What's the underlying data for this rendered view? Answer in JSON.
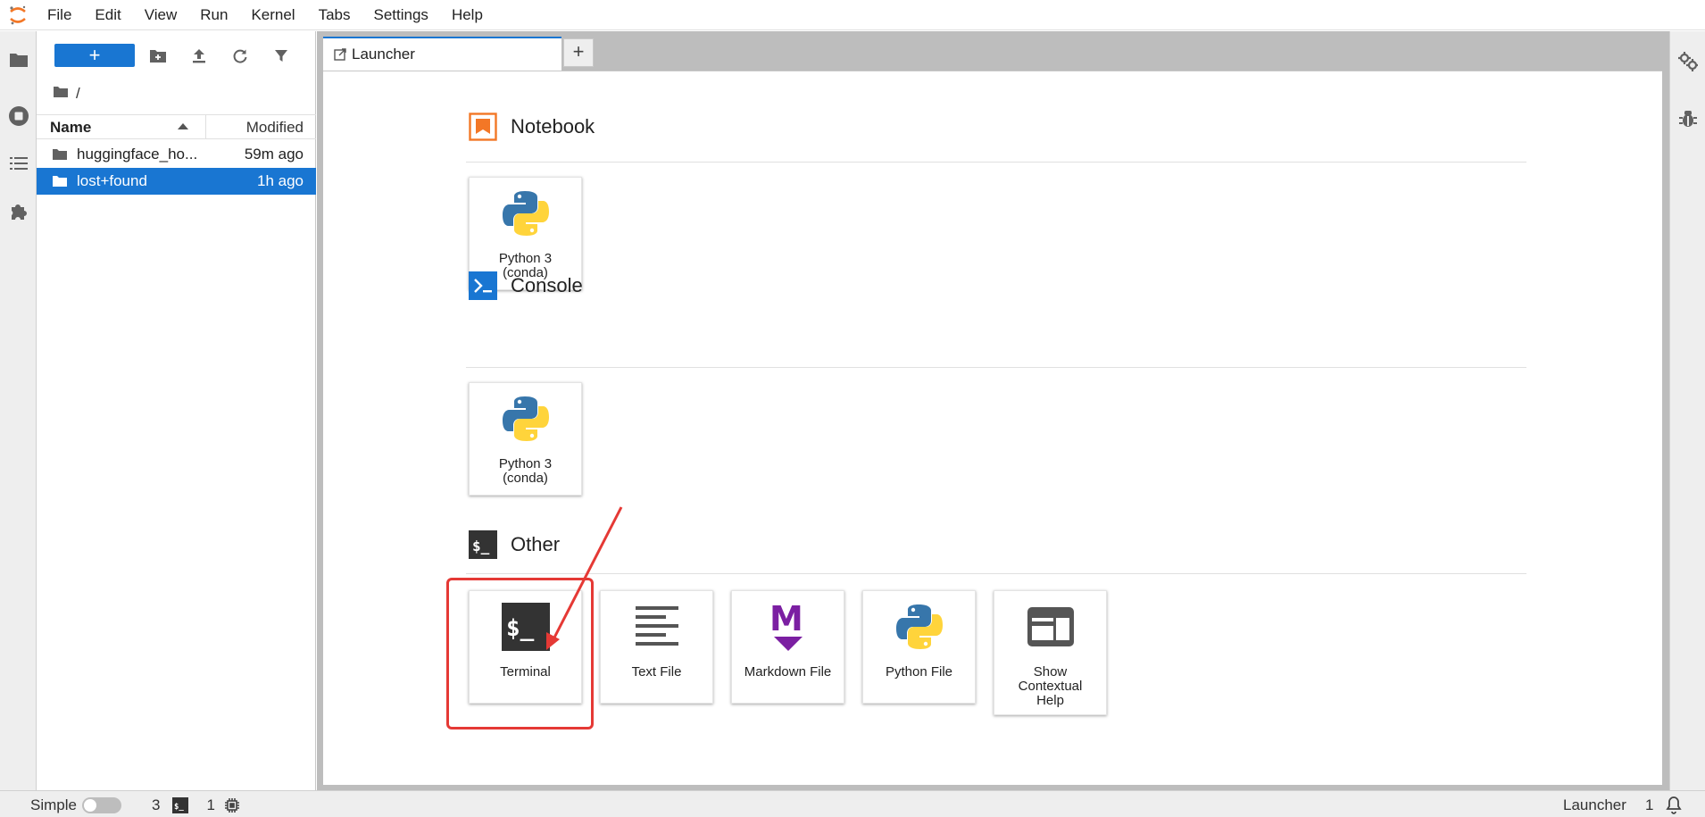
{
  "menubar": {
    "items": [
      "File",
      "Edit",
      "View",
      "Run",
      "Kernel",
      "Tabs",
      "Settings",
      "Help"
    ]
  },
  "filebrowser": {
    "new_label": "+",
    "breadcrumb": "/",
    "columns": {
      "name": "Name",
      "modified": "Modified"
    },
    "rows": [
      {
        "name": "huggingface_ho...",
        "modified": "59m ago"
      },
      {
        "name": "lost+found",
        "modified": "1h ago"
      }
    ]
  },
  "tabs": {
    "active_label": "Launcher",
    "add_label": "+"
  },
  "launcher": {
    "notebook": {
      "title": "Notebook",
      "cards": [
        {
          "line1": "Python 3",
          "line2": "(conda)"
        }
      ]
    },
    "console": {
      "title": "Console",
      "cards": [
        {
          "line1": "Python 3",
          "line2": "(conda)"
        }
      ]
    },
    "other": {
      "title": "Other",
      "cards": [
        {
          "label": "Terminal"
        },
        {
          "label": "Text File"
        },
        {
          "label": "Markdown File"
        },
        {
          "label": "Python File"
        },
        {
          "line1": "Show",
          "line2": "Contextual",
          "line3": "Help"
        }
      ]
    }
  },
  "statusbar": {
    "mode_label": "Simple",
    "kernels_count": "3",
    "terminals_count": "1",
    "right_label": "Launcher",
    "notifications_count": "1"
  },
  "colors": {
    "accent": "#1976d2",
    "annotation": "#e53935",
    "notebook_orange": "#f37726",
    "console_blue": "#1976d2",
    "markdown_purple": "#7b1fa2"
  }
}
